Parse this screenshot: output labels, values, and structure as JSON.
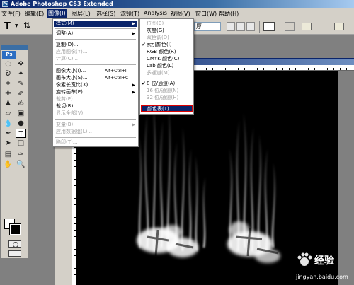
{
  "window": {
    "title": "Adobe Photoshop CS3 Extended",
    "app_badge": "Ps"
  },
  "menubar": [
    {
      "label": "文件(F)"
    },
    {
      "label": "编辑(E)"
    },
    {
      "label": "图像(I)"
    },
    {
      "label": "图层(L)"
    },
    {
      "label": "选择(S)"
    },
    {
      "label": "滤镜(T)"
    },
    {
      "label": "Analysis"
    },
    {
      "label": "视图(V)"
    },
    {
      "label": "窗口(W)"
    },
    {
      "label": "帮助(H)"
    }
  ],
  "optionsbar": {
    "tool_glyph": "T",
    "font_style": "厚"
  },
  "toolbox": {
    "badge": "Ps"
  },
  "image_menu": {
    "items": [
      {
        "label": "模式(M)",
        "submenu": true,
        "state": "highlighted"
      },
      {
        "label": "调整(A)",
        "submenu": true
      },
      {
        "label": "复制(D)..."
      },
      {
        "label": "应用图像(Y)...",
        "state": "disabled"
      },
      {
        "label": "计算(C)...",
        "state": "disabled"
      },
      {
        "label": "图像大小(I)...",
        "shortcut": "Alt+Ctrl+I"
      },
      {
        "label": "画布大小(S)...",
        "shortcut": "Alt+Ctrl+C"
      },
      {
        "label": "像素长宽比(X)",
        "submenu": true
      },
      {
        "label": "旋转画布(E)",
        "submenu": true
      },
      {
        "label": "裁剪(P)",
        "state": "disabled"
      },
      {
        "label": "裁切(R)..."
      },
      {
        "label": "显示全部(V)",
        "state": "disabled"
      },
      {
        "label": "变量(B)",
        "submenu": true,
        "state": "disabled"
      },
      {
        "label": "应用数据组(L)...",
        "state": "disabled"
      },
      {
        "label": "陷印(T)...",
        "state": "disabled"
      }
    ]
  },
  "mode_submenu": {
    "items": [
      {
        "label": "位图(B)",
        "state": "disabled"
      },
      {
        "label": "灰度(G)"
      },
      {
        "label": "双色调(D)",
        "state": "disabled"
      },
      {
        "label": "索引颜色(I)",
        "checked": true
      },
      {
        "label": "RGB 颜色(R)"
      },
      {
        "label": "CMYK 颜色(C)"
      },
      {
        "label": "Lab 颜色(L)"
      },
      {
        "label": "多通道(M)",
        "state": "disabled"
      },
      {
        "label": "8 位/通道(A)",
        "checked": true
      },
      {
        "label": "16 位/通道(N)",
        "state": "disabled"
      },
      {
        "label": "32 位/通道(H)",
        "state": "disabled"
      },
      {
        "label": "颜色表(T)...",
        "state": "highlighted"
      }
    ]
  },
  "canvas_text": "燃烧",
  "watermark": {
    "brand": "经验",
    "url": "jingyan.baidu.com"
  },
  "colors": {
    "menu_highlight": "#0a246a",
    "title_blue": "#0a246a",
    "disabled_text": "#a0a0a0",
    "callout_red": "#dd0000"
  }
}
